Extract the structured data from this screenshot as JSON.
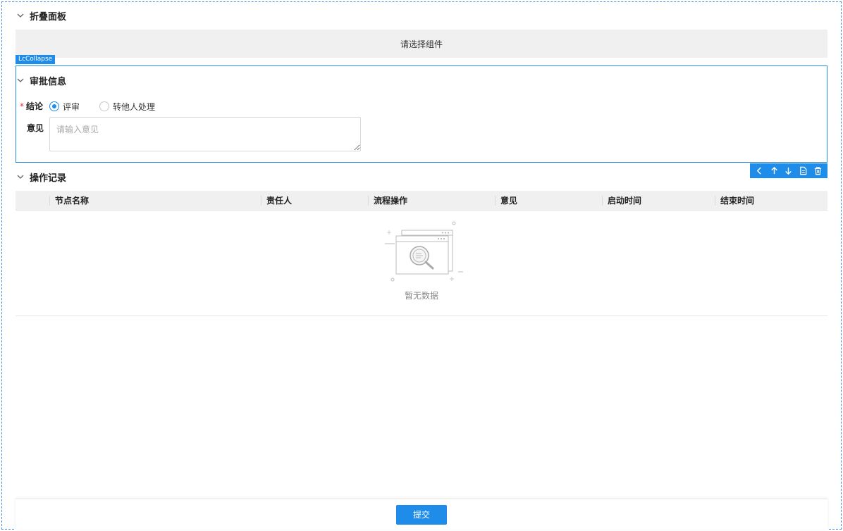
{
  "collapse_panel": {
    "title": "折叠面板",
    "placeholder": "请选择组件"
  },
  "component_tag": "LcCollapse",
  "approval": {
    "title": "审批信息",
    "conclusion_label": "结论",
    "required_mark": "*",
    "options": [
      {
        "label": "评审",
        "selected": true
      },
      {
        "label": "转他人处理",
        "selected": false
      }
    ],
    "opinion_label": "意见",
    "opinion_placeholder": "请输入意见",
    "opinion_value": ""
  },
  "toolbar": {
    "icons": [
      "chevron-left-icon",
      "arrow-up-icon",
      "arrow-down-icon",
      "copy-icon",
      "delete-icon"
    ]
  },
  "records": {
    "title": "操作记录",
    "columns": [
      "",
      "节点名称",
      "责任人",
      "流程操作",
      "意见",
      "启动时间",
      "结束时间"
    ],
    "rows": [],
    "empty_text": "暂无数据"
  },
  "footer": {
    "submit_label": "提交"
  },
  "colors": {
    "accent": "#1e8ce8",
    "required": "#e0323a",
    "header_bg": "#f0f0f0"
  }
}
